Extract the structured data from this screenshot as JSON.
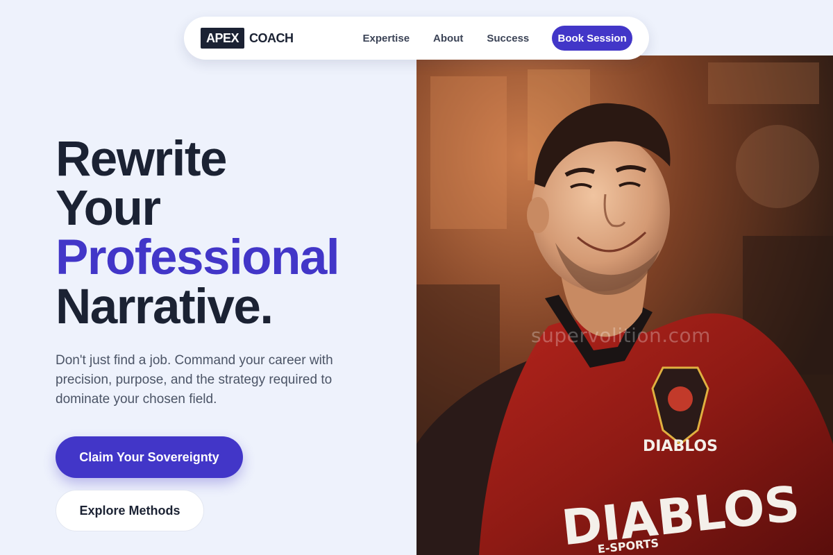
{
  "nav": {
    "logo_box": "APEX",
    "logo_text": "COACH",
    "links": [
      "Expertise",
      "About",
      "Success"
    ],
    "cta": "Book Session"
  },
  "hero": {
    "headline": {
      "line1": "Rewrite",
      "line2": "Your",
      "line3": "Professional",
      "line4": "Narrative."
    },
    "subtext": "Don't just find a job. Command your career with precision, purpose, and the strategy required to dominate your chosen field.",
    "primary_button": "Claim Your Sovereignty",
    "secondary_button": "Explore Methods"
  },
  "photo": {
    "alt": "smiling man in red Diablos esports jersey",
    "jersey_text": "DIABLOS",
    "jersey_subtext": "E-SPORTS"
  },
  "watermark": "supervolition.com",
  "colors": {
    "accent": "#4236c8",
    "dark": "#1b2233",
    "background": "#eef2fc"
  }
}
